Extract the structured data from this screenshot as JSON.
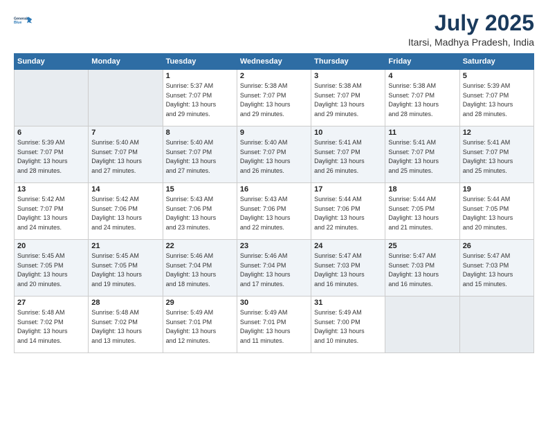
{
  "logo": {
    "line1": "General",
    "line2": "Blue"
  },
  "title": "July 2025",
  "location": "Itarsi, Madhya Pradesh, India",
  "headers": [
    "Sunday",
    "Monday",
    "Tuesday",
    "Wednesday",
    "Thursday",
    "Friday",
    "Saturday"
  ],
  "weeks": [
    [
      {
        "day": "",
        "info": ""
      },
      {
        "day": "",
        "info": ""
      },
      {
        "day": "1",
        "info": "Sunrise: 5:37 AM\nSunset: 7:07 PM\nDaylight: 13 hours\nand 29 minutes."
      },
      {
        "day": "2",
        "info": "Sunrise: 5:38 AM\nSunset: 7:07 PM\nDaylight: 13 hours\nand 29 minutes."
      },
      {
        "day": "3",
        "info": "Sunrise: 5:38 AM\nSunset: 7:07 PM\nDaylight: 13 hours\nand 29 minutes."
      },
      {
        "day": "4",
        "info": "Sunrise: 5:38 AM\nSunset: 7:07 PM\nDaylight: 13 hours\nand 28 minutes."
      },
      {
        "day": "5",
        "info": "Sunrise: 5:39 AM\nSunset: 7:07 PM\nDaylight: 13 hours\nand 28 minutes."
      }
    ],
    [
      {
        "day": "6",
        "info": "Sunrise: 5:39 AM\nSunset: 7:07 PM\nDaylight: 13 hours\nand 28 minutes."
      },
      {
        "day": "7",
        "info": "Sunrise: 5:40 AM\nSunset: 7:07 PM\nDaylight: 13 hours\nand 27 minutes."
      },
      {
        "day": "8",
        "info": "Sunrise: 5:40 AM\nSunset: 7:07 PM\nDaylight: 13 hours\nand 27 minutes."
      },
      {
        "day": "9",
        "info": "Sunrise: 5:40 AM\nSunset: 7:07 PM\nDaylight: 13 hours\nand 26 minutes."
      },
      {
        "day": "10",
        "info": "Sunrise: 5:41 AM\nSunset: 7:07 PM\nDaylight: 13 hours\nand 26 minutes."
      },
      {
        "day": "11",
        "info": "Sunrise: 5:41 AM\nSunset: 7:07 PM\nDaylight: 13 hours\nand 25 minutes."
      },
      {
        "day": "12",
        "info": "Sunrise: 5:41 AM\nSunset: 7:07 PM\nDaylight: 13 hours\nand 25 minutes."
      }
    ],
    [
      {
        "day": "13",
        "info": "Sunrise: 5:42 AM\nSunset: 7:07 PM\nDaylight: 13 hours\nand 24 minutes."
      },
      {
        "day": "14",
        "info": "Sunrise: 5:42 AM\nSunset: 7:06 PM\nDaylight: 13 hours\nand 24 minutes."
      },
      {
        "day": "15",
        "info": "Sunrise: 5:43 AM\nSunset: 7:06 PM\nDaylight: 13 hours\nand 23 minutes."
      },
      {
        "day": "16",
        "info": "Sunrise: 5:43 AM\nSunset: 7:06 PM\nDaylight: 13 hours\nand 22 minutes."
      },
      {
        "day": "17",
        "info": "Sunrise: 5:44 AM\nSunset: 7:06 PM\nDaylight: 13 hours\nand 22 minutes."
      },
      {
        "day": "18",
        "info": "Sunrise: 5:44 AM\nSunset: 7:05 PM\nDaylight: 13 hours\nand 21 minutes."
      },
      {
        "day": "19",
        "info": "Sunrise: 5:44 AM\nSunset: 7:05 PM\nDaylight: 13 hours\nand 20 minutes."
      }
    ],
    [
      {
        "day": "20",
        "info": "Sunrise: 5:45 AM\nSunset: 7:05 PM\nDaylight: 13 hours\nand 20 minutes."
      },
      {
        "day": "21",
        "info": "Sunrise: 5:45 AM\nSunset: 7:05 PM\nDaylight: 13 hours\nand 19 minutes."
      },
      {
        "day": "22",
        "info": "Sunrise: 5:46 AM\nSunset: 7:04 PM\nDaylight: 13 hours\nand 18 minutes."
      },
      {
        "day": "23",
        "info": "Sunrise: 5:46 AM\nSunset: 7:04 PM\nDaylight: 13 hours\nand 17 minutes."
      },
      {
        "day": "24",
        "info": "Sunrise: 5:47 AM\nSunset: 7:03 PM\nDaylight: 13 hours\nand 16 minutes."
      },
      {
        "day": "25",
        "info": "Sunrise: 5:47 AM\nSunset: 7:03 PM\nDaylight: 13 hours\nand 16 minutes."
      },
      {
        "day": "26",
        "info": "Sunrise: 5:47 AM\nSunset: 7:03 PM\nDaylight: 13 hours\nand 15 minutes."
      }
    ],
    [
      {
        "day": "27",
        "info": "Sunrise: 5:48 AM\nSunset: 7:02 PM\nDaylight: 13 hours\nand 14 minutes."
      },
      {
        "day": "28",
        "info": "Sunrise: 5:48 AM\nSunset: 7:02 PM\nDaylight: 13 hours\nand 13 minutes."
      },
      {
        "day": "29",
        "info": "Sunrise: 5:49 AM\nSunset: 7:01 PM\nDaylight: 13 hours\nand 12 minutes."
      },
      {
        "day": "30",
        "info": "Sunrise: 5:49 AM\nSunset: 7:01 PM\nDaylight: 13 hours\nand 11 minutes."
      },
      {
        "day": "31",
        "info": "Sunrise: 5:49 AM\nSunset: 7:00 PM\nDaylight: 13 hours\nand 10 minutes."
      },
      {
        "day": "",
        "info": ""
      },
      {
        "day": "",
        "info": ""
      }
    ]
  ]
}
